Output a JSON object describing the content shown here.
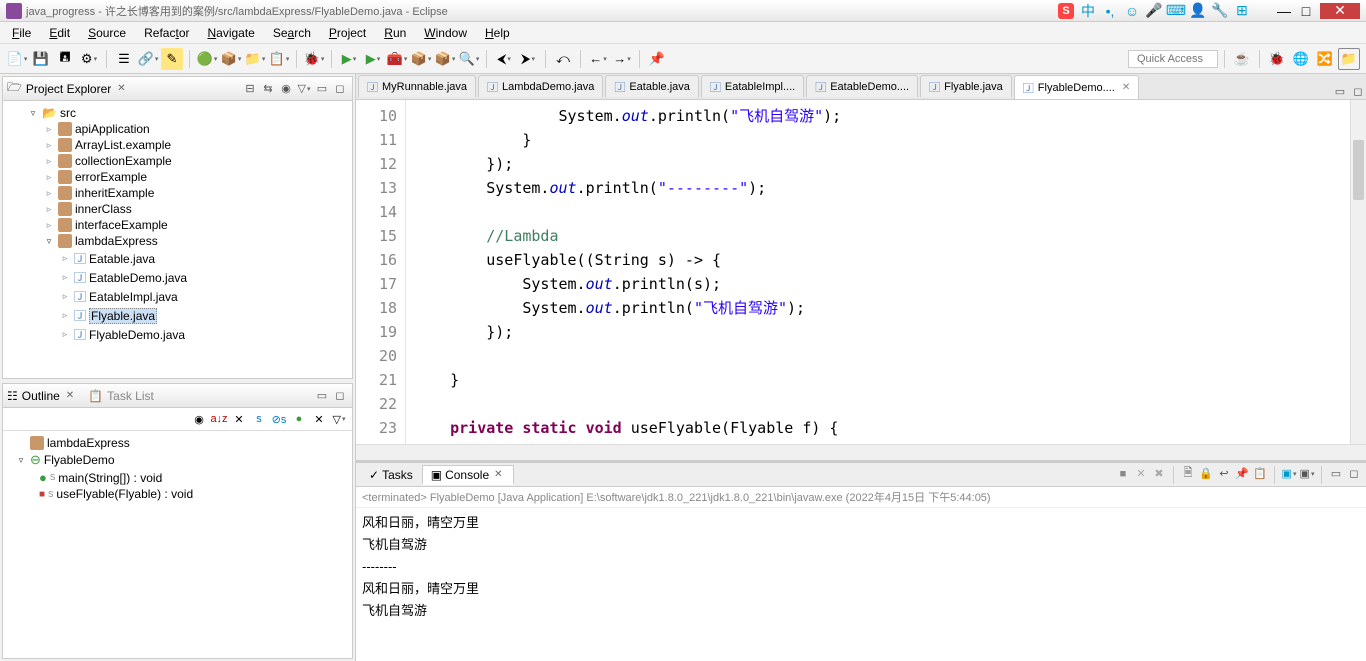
{
  "window": {
    "title": "java_progress - 许之长博客用到的案例/src/lambdaExpress/FlyableDemo.java - Eclipse"
  },
  "menu": [
    "File",
    "Edit",
    "Source",
    "Refactor",
    "Navigate",
    "Search",
    "Project",
    "Run",
    "Window",
    "Help"
  ],
  "quick_access": "Quick Access",
  "project_explorer": {
    "title": "Project Explorer",
    "root": "src",
    "packages": [
      "apiApplication",
      "ArrayList.example",
      "collectionExample",
      "errorExample",
      "inheritExample",
      "innerClass",
      "interfaceExample"
    ],
    "open_package": "lambdaExpress",
    "files": [
      "Eatable.java",
      "EatableDemo.java",
      "EatableImpl.java",
      "Flyable.java",
      "FlyableDemo.java"
    ],
    "selected": "Flyable.java"
  },
  "outline": {
    "title": "Outline",
    "tasklist": "Task List",
    "package": "lambdaExpress",
    "class": "FlyableDemo",
    "methods": [
      {
        "name": "main(String[]) : void",
        "vis": "public"
      },
      {
        "name": "useFlyable(Flyable) : void",
        "vis": "private"
      }
    ]
  },
  "editor": {
    "tabs": [
      "MyRunnable.java",
      "LambdaDemo.java",
      "Eatable.java",
      "EatableImpl....",
      "EatableDemo....",
      "Flyable.java",
      "FlyableDemo...."
    ],
    "active_tab": 6,
    "first_line": 10,
    "lines": [
      {
        "n": 10,
        "html": "                System.<i class='it'>out</i>.println(<span class='str'>\"飞机自驾游\"</span>);"
      },
      {
        "n": 11,
        "html": "            }"
      },
      {
        "n": 12,
        "html": "        });"
      },
      {
        "n": 13,
        "html": "        System.<i class='it'>out</i>.println(<span class='str'>\"--------\"</span>);"
      },
      {
        "n": 14,
        "html": ""
      },
      {
        "n": 15,
        "html": "        <span class='cm'>//Lambda</span>"
      },
      {
        "n": 16,
        "html": "        useFlyable((String s) -> {"
      },
      {
        "n": 17,
        "html": "            System.<i class='it'>out</i>.println(s);"
      },
      {
        "n": 18,
        "html": "            System.<i class='it'>out</i>.println(<span class='str'>\"飞机自驾游\"</span>);"
      },
      {
        "n": 19,
        "html": "        });"
      },
      {
        "n": 20,
        "html": ""
      },
      {
        "n": 21,
        "html": "    }"
      },
      {
        "n": 22,
        "html": ""
      },
      {
        "n": 23,
        "html": "    <span class='kw'>private static void</span> useFlyable(Flyable f) {"
      }
    ]
  },
  "console": {
    "tabs": {
      "tasks": "Tasks",
      "console": "Console"
    },
    "header": "<terminated> FlyableDemo [Java Application] E:\\software\\jdk1.8.0_221\\jdk1.8.0_221\\bin\\javaw.exe (2022年4月15日 下午5:44:05)",
    "output": "风和日丽，晴空万里\n飞机自驾游\n--------\n风和日丽，晴空万里\n飞机自驾游"
  }
}
